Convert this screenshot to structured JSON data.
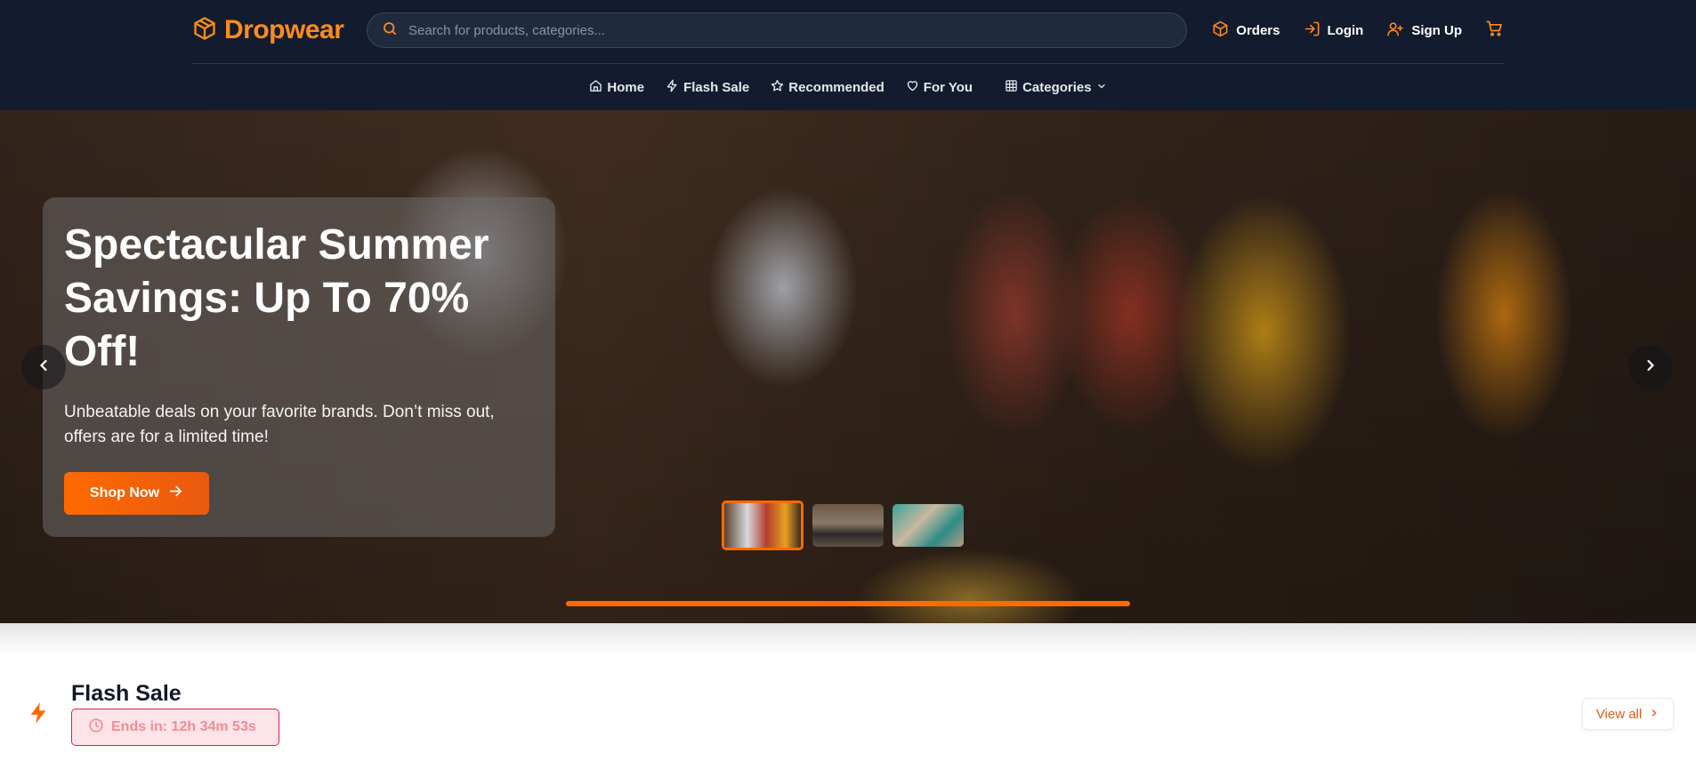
{
  "brand": {
    "name": "Dropwear",
    "accent": "#fb8c1b"
  },
  "search": {
    "placeholder": "Search for products, categories..."
  },
  "header_actions": [
    {
      "label": "Orders",
      "icon": "box-icon"
    },
    {
      "label": "Login",
      "icon": "login-icon"
    },
    {
      "label": "Sign Up",
      "icon": "user-plus-icon"
    },
    {
      "label": "",
      "icon": "cart-icon"
    }
  ],
  "nav": {
    "items": [
      {
        "label": "Home",
        "icon": "home-icon"
      },
      {
        "label": "Flash Sale",
        "icon": "bolt-icon"
      },
      {
        "label": "Recommended",
        "icon": "star-icon"
      },
      {
        "label": "For You",
        "icon": "heart-icon"
      }
    ],
    "categories": {
      "label": "Categories",
      "icon": "grid-icon"
    }
  },
  "hero": {
    "title": "Spectacular Summer Savings: Up To 70% Off!",
    "subtitle": "Unbeatable deals on your favorite brands. Don’t miss out, offers are for a limited time!",
    "cta": "Shop Now",
    "slides": 3,
    "active_slide": 1,
    "progress": 1.0
  },
  "flash_sale": {
    "title": "Flash Sale",
    "timer": "Ends in: 12h 34m 53s",
    "view_all": "View all"
  },
  "colors": {
    "header_bg": "#131b2e",
    "cta": "#ff6a00",
    "timer_border": "#e11d48"
  }
}
